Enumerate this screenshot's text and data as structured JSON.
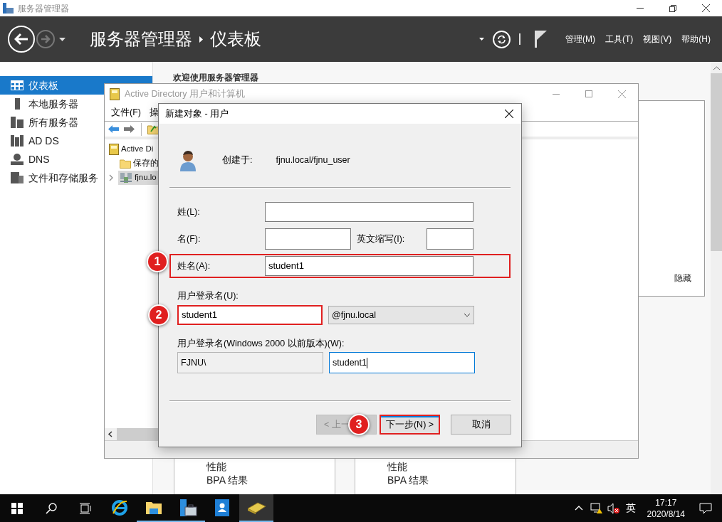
{
  "window": {
    "title": "服务器管理器"
  },
  "header": {
    "breadcrumb": [
      "服务器管理器",
      "仪表板"
    ],
    "menus": [
      "管理(M)",
      "工具(T)",
      "视图(V)",
      "帮助(H)"
    ]
  },
  "sidebar": {
    "items": [
      {
        "label": "仪表板",
        "kind": "dashboard",
        "selected": true
      },
      {
        "label": "本地服务器",
        "kind": "server",
        "selected": false
      },
      {
        "label": "所有服务器",
        "kind": "servers",
        "selected": false
      },
      {
        "label": "AD DS",
        "kind": "adds",
        "selected": false
      },
      {
        "label": "DNS",
        "kind": "dns",
        "selected": false
      },
      {
        "label": "文件和存储服务",
        "kind": "files",
        "selected": false
      }
    ]
  },
  "dashboard": {
    "welcome": "欢迎使用服务器管理器",
    "hide_link": "隐藏",
    "tiles": [
      {
        "line_1": "性能",
        "line_2": "BPA 结果"
      },
      {
        "line_1": "性能",
        "line_2": "BPA 结果"
      }
    ]
  },
  "ad_window": {
    "title": "Active Directory 用户和计算机",
    "menus": [
      "文件(F)",
      "操"
    ],
    "tree": [
      {
        "label": "Active Di",
        "kind": "root",
        "selected": false,
        "children": [
          {
            "label": "保存的",
            "kind": "folder",
            "selected": false
          },
          {
            "label": "fjnu.lo",
            "kind": "domain",
            "selected": true
          }
        ]
      }
    ]
  },
  "dialog": {
    "title": "新建对象 - 用户",
    "created_in_label": "创建于:",
    "created_in": "fjnu.local/fjnu_user",
    "last_name": {
      "label": "姓(L):"
    },
    "first_name": {
      "label": "名(F):"
    },
    "initials": {
      "label": "英文缩写(I):"
    },
    "full_name": {
      "label": "姓名(A):",
      "value": "student1",
      "marker": "1"
    },
    "logon_name": {
      "label": "用户登录名(U):",
      "value": "student1",
      "domain": "@fjnu.local",
      "marker": "2"
    },
    "pre2000": {
      "label": "用户登录名(Windows 2000 以前版本)(W):",
      "prefix": "FJNU\\",
      "value": "student1",
      "focused": true
    },
    "buttons": [
      {
        "label": "< 上一",
        "disabled": true
      },
      {
        "label": "下一步(N) >",
        "disabled": false,
        "marker": "3"
      },
      {
        "label": "取消",
        "disabled": false
      }
    ]
  },
  "taskbar": {
    "apps": [
      {
        "kind": "ie",
        "running": false,
        "selected": false
      },
      {
        "kind": "explorer",
        "running": true,
        "selected": false
      },
      {
        "kind": "server-manager",
        "running": true,
        "selected": false
      },
      {
        "kind": "contacts",
        "running": false,
        "selected": false
      },
      {
        "kind": "ad-tool",
        "running": true,
        "selected": true
      }
    ],
    "ime": "英",
    "time": "17:17",
    "date": "2020/8/14"
  }
}
